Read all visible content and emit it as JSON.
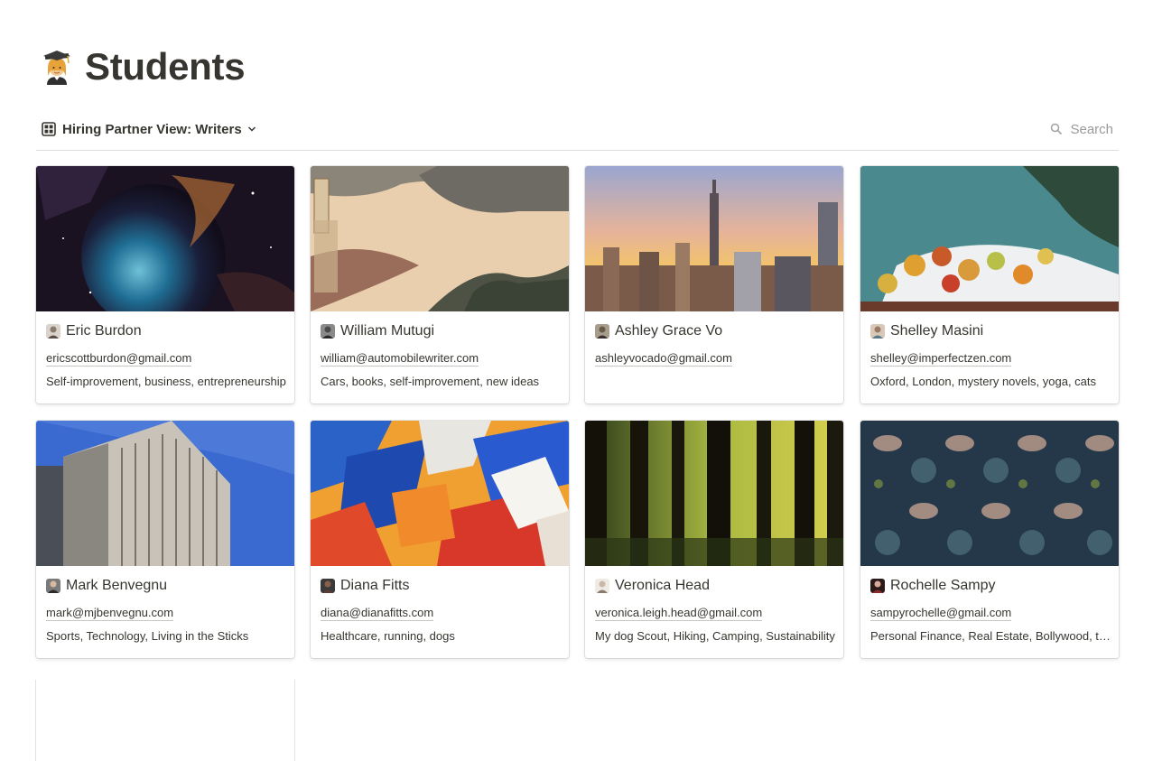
{
  "page": {
    "icon": "student-emoji-icon",
    "title": "Students"
  },
  "toolbar": {
    "view_icon": "gallery-view-icon",
    "view_label": "Hiring Partner View: Writers",
    "search_label": "Search"
  },
  "cards": [
    {
      "name": "Eric Burdon",
      "email": "ericscottburdon@gmail.com",
      "topics": "Self-improvement, business, entrepreneurship",
      "cover": "space-nebula",
      "avatar_color": "#8b7b6a"
    },
    {
      "name": "William Mutugi",
      "email": "william@automobilewriter.com",
      "topics": "Cars, books, self-improvement, new ideas",
      "cover": "japanese-woodblock",
      "avatar_color": "#4a4a4a"
    },
    {
      "name": "Ashley Grace Vo",
      "email": "ashleyvocado@gmail.com",
      "topics": "",
      "cover": "city-sunset",
      "avatar_color": "#6b5a4a"
    },
    {
      "name": "Shelley Masini",
      "email": "shelley@imperfectzen.com",
      "topics": "Oxford, London, mystery novels, yoga, cats",
      "cover": "still-life-fruit",
      "avatar_color": "#9a7a64"
    },
    {
      "name": "Mark Benvegnu",
      "email": "mark@mjbenvegnu.com",
      "topics": "Sports, Technology, Living in the Sticks",
      "cover": "skyscraper",
      "avatar_color": "#3e3e3e"
    },
    {
      "name": "Diana Fitts",
      "email": "diana@dianafitts.com",
      "topics": "Healthcare, running, dogs",
      "cover": "abstract-paint",
      "avatar_color": "#5a3e36"
    },
    {
      "name": "Veronica Head",
      "email": "veronica.leigh.head@gmail.com",
      "topics": "My dog Scout, Hiking, Camping, Sustainability",
      "cover": "forest-trees",
      "avatar_color": "#c9b8a8"
    },
    {
      "name": "Rochelle Sampy",
      "email": "sampyrochelle@gmail.com",
      "topics": "Personal Finance, Real Estate, Bollywood, travel",
      "cover": "bird-pattern",
      "avatar_color": "#8a2a2a"
    }
  ]
}
